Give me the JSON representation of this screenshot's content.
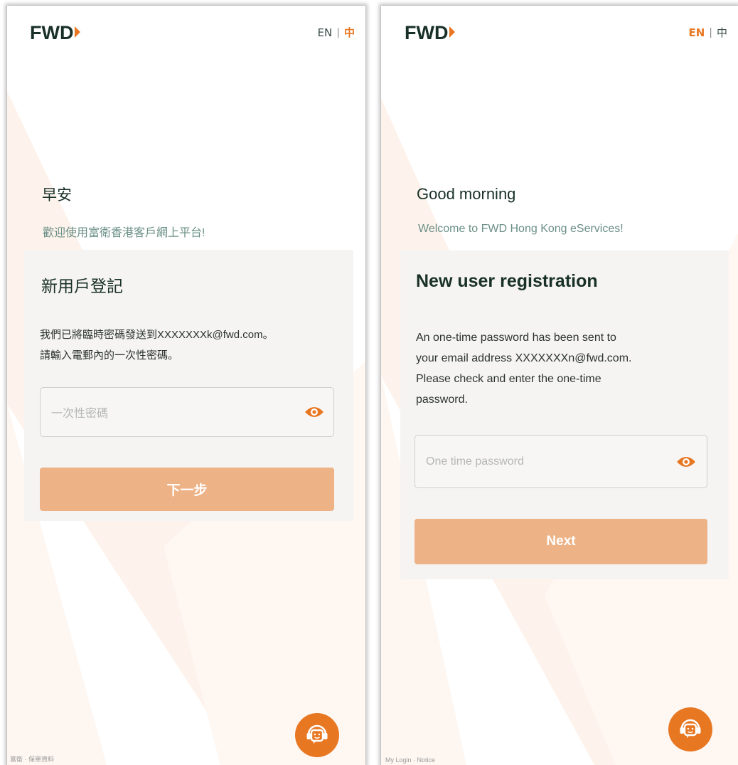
{
  "colors": {
    "brand_orange": "#e87722",
    "button_disabled": "#edb285",
    "heading_dark_green": "#183028",
    "welcome_green": "#6a8f86"
  },
  "screens": [
    {
      "id": "zh",
      "logo_text": "FWD",
      "language": {
        "en_label": "EN",
        "separator": "|",
        "zh_label": "中",
        "active": "zh"
      },
      "greeting": "早安",
      "welcome": "歡迎使用富衛香港客戶網上平台!",
      "card": {
        "title": "新用戶登記",
        "message_line1": "我們已將臨時密碼發送到XXXXXXXk@fwd.com。",
        "message_line2": "請輸入電郵內的一次性密碼。",
        "otp_placeholder": "一次性密碼",
        "next_label": "下一步"
      },
      "footer_text": "富衛 · 保單資料",
      "icons": {
        "eye": "eye-icon",
        "chat": "chat-support-icon"
      }
    },
    {
      "id": "en",
      "logo_text": "FWD",
      "language": {
        "en_label": "EN",
        "separator": "|",
        "zh_label": "中",
        "active": "en"
      },
      "greeting": "Good morning",
      "welcome": "Welcome to FWD Hong Kong eServices!",
      "card": {
        "title": "New user registration",
        "message_line1": "An one-time password has been sent to",
        "message_line2": "your email address XXXXXXXn@fwd.com.",
        "message_line3": "Please check and enter the one-time",
        "message_line4": "password.",
        "otp_placeholder": "One time password",
        "next_label": "Next"
      },
      "footer_text": "My Login · Notice",
      "icons": {
        "eye": "eye-icon",
        "chat": "chat-support-icon"
      }
    }
  ]
}
